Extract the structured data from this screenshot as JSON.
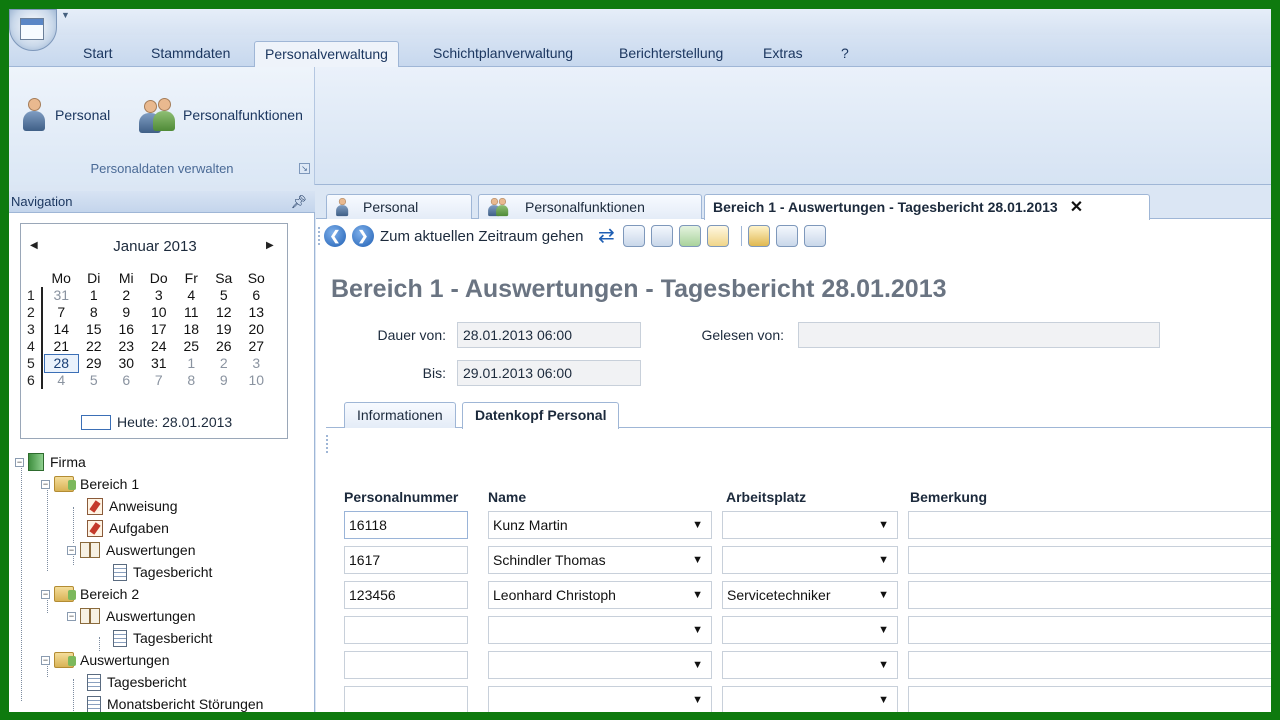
{
  "ribbon": {
    "tabs": [
      "Start",
      "Stammdaten",
      "Personalverwaltung",
      "Schichtplanverwaltung",
      "Berichterstellung",
      "Extras",
      "?"
    ],
    "active_tab": "Personalverwaltung",
    "group": {
      "buttons": [
        "Personal",
        "Personalfunktionen"
      ],
      "label": "Personaldaten verwalten"
    }
  },
  "nav": {
    "title": "Navigation",
    "calendar": {
      "month": "Januar 2013",
      "weekdays": [
        "Mo",
        "Di",
        "Mi",
        "Do",
        "Fr",
        "Sa",
        "So"
      ],
      "weeks": [
        {
          "wk": "1",
          "days": [
            "31",
            "1",
            "2",
            "3",
            "4",
            "5",
            "6"
          ]
        },
        {
          "wk": "2",
          "days": [
            "7",
            "8",
            "9",
            "10",
            "11",
            "12",
            "13"
          ]
        },
        {
          "wk": "3",
          "days": [
            "14",
            "15",
            "16",
            "17",
            "18",
            "19",
            "20"
          ]
        },
        {
          "wk": "4",
          "days": [
            "21",
            "22",
            "23",
            "24",
            "25",
            "26",
            "27"
          ]
        },
        {
          "wk": "5",
          "days": [
            "28",
            "29",
            "30",
            "31",
            "1",
            "2",
            "3"
          ]
        },
        {
          "wk": "6",
          "days": [
            "4",
            "5",
            "6",
            "7",
            "8",
            "9",
            "10"
          ]
        }
      ],
      "today_label": "Heute: 28.01.2013"
    },
    "tree": {
      "firma": "Firma",
      "bereich1": "Bereich 1",
      "anweisung": "Anweisung",
      "aufgaben": "Aufgaben",
      "auswertungen1": "Auswertungen",
      "tagesbericht1": "Tagesbericht",
      "bereich2": "Bereich 2",
      "auswertungen2": "Auswertungen",
      "tagesbericht2": "Tagesbericht",
      "auswertungen3": "Auswertungen",
      "tagesbericht3": "Tagesbericht",
      "monatsbericht": "Monatsbericht Störungen"
    }
  },
  "main": {
    "doc_tabs": [
      "Personal",
      "Personalfunktionen",
      "Bereich 1 - Auswertungen - Tagesbericht 28.01.2013"
    ],
    "toolbar_label": "Zum aktuellen Zeitraum gehen",
    "title": "Bereich 1 - Auswertungen - Tagesbericht 28.01.2013",
    "fields": {
      "dauer_label": "Dauer von:",
      "dauer_value": "28.01.2013 06:00",
      "bis_label": "Bis:",
      "bis_value": "29.01.2013 06:00",
      "gelesen_label": "Gelesen von:",
      "gelesen_value": ""
    },
    "sub_tabs": [
      "Informationen",
      "Datenkopf Personal"
    ],
    "grid": {
      "headers": [
        "Personalnummer",
        "Name",
        "Arbeitsplatz",
        "Bemerkung"
      ],
      "rows": [
        [
          "16118",
          "Kunz Martin",
          "",
          ""
        ],
        [
          "1617",
          "Schindler Thomas",
          "",
          ""
        ],
        [
          "123456",
          "Leonhard Christoph",
          "Servicetechniker",
          ""
        ],
        [
          "",
          "",
          "",
          ""
        ],
        [
          "",
          "",
          "",
          ""
        ],
        [
          "",
          "",
          "",
          ""
        ]
      ]
    }
  }
}
